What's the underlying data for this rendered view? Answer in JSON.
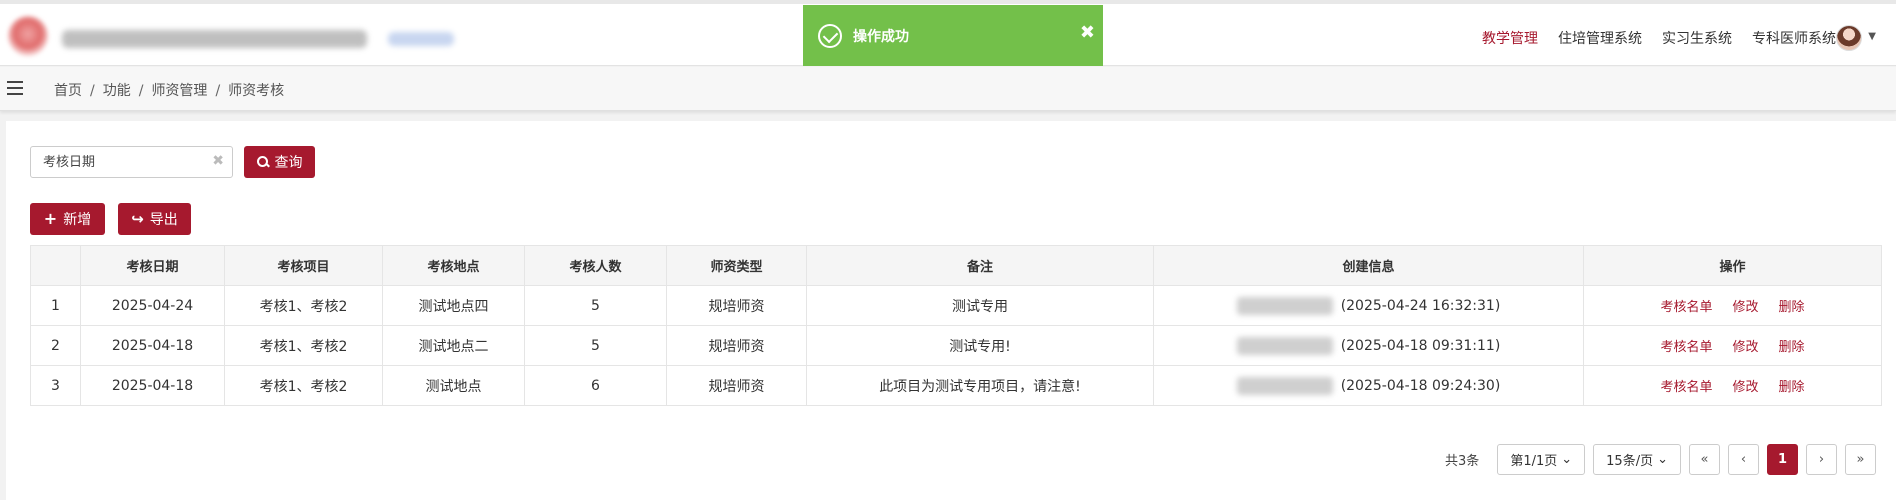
{
  "header": {
    "nav": [
      "教学管理",
      "住培管理系统",
      "实习生系统",
      "专科医师系统"
    ],
    "active_index": 0
  },
  "toast": {
    "message": "操作成功",
    "close": "✖"
  },
  "breadcrumb": [
    "首页",
    "功能",
    "师资管理",
    "师资考核"
  ],
  "search": {
    "placeholder": "考核日期",
    "value": "",
    "clear": "✖",
    "button": "查询"
  },
  "actions": {
    "add": "新增",
    "export": "导出"
  },
  "table": {
    "columns": [
      "",
      "考核日期",
      "考核项目",
      "考核地点",
      "考核人数",
      "师资类型",
      "备注",
      "创建信息",
      "操作"
    ],
    "rows": [
      {
        "idx": "1",
        "date": "2025-04-24",
        "items": "考核1、考核2",
        "place": "测试地点四",
        "count": "5",
        "type": "规培师资",
        "remark": "测试专用",
        "created": "(2025-04-24 16:32:31)"
      },
      {
        "idx": "2",
        "date": "2025-04-18",
        "items": "考核1、考核2",
        "place": "测试地点二",
        "count": "5",
        "type": "规培师资",
        "remark": "测试专用!",
        "created": "(2025-04-18 09:31:11)"
      },
      {
        "idx": "3",
        "date": "2025-04-18",
        "items": "考核1、考核2",
        "place": "测试地点",
        "count": "6",
        "type": "规培师资",
        "remark": "此项目为测试专用项目，请注意!",
        "created": "(2025-04-18 09:24:30)"
      }
    ],
    "row_actions": [
      "考核名单",
      "修改",
      "删除"
    ]
  },
  "pagination": {
    "total": "共3条",
    "page": "第1/1页",
    "page_size": "15条/页",
    "first": "«",
    "prev": "‹",
    "current": "1",
    "next": "›",
    "last": "»"
  },
  "colors": {
    "brand": "#a6192e",
    "toast": "#73c04a"
  }
}
